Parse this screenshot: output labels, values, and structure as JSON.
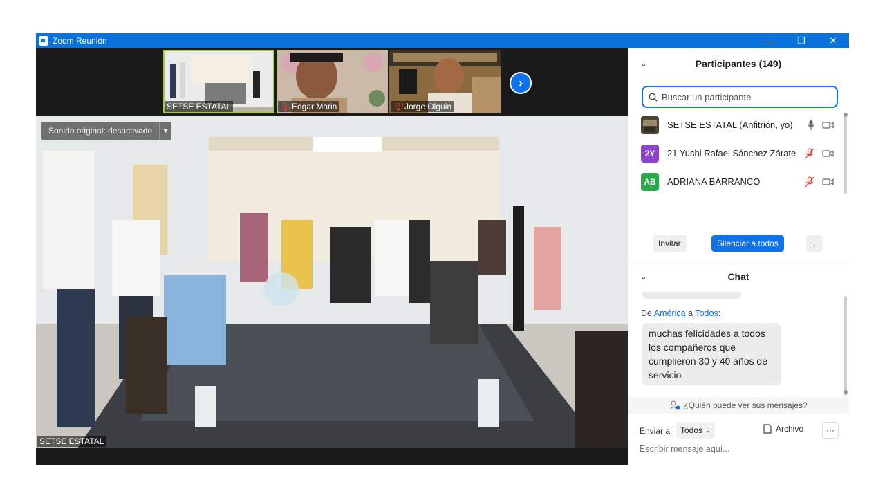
{
  "window": {
    "title": "Zoom Reunión",
    "controls": {
      "minimize": "—",
      "restore": "❐",
      "close": "✕"
    }
  },
  "thumbnails": [
    {
      "name": "SETSE ESTATAL",
      "muted": false,
      "active": true
    },
    {
      "name": "Edgar Marin",
      "muted": true,
      "active": false
    },
    {
      "name": "Jorge Olguin",
      "muted": true,
      "active": false
    }
  ],
  "next_icon": "chevron-right-icon",
  "main_video": {
    "audio_pill": "Sonido original: desactivado",
    "speaker_name": "SETSE ESTATAL"
  },
  "participants": {
    "title": "Participantes (149)",
    "search_placeholder": "Buscar un participante",
    "list": [
      {
        "initials": "",
        "name": "SETSE ESTATAL (Anfitrión, yo)",
        "avatar_color": "#6b5a3e",
        "mic": "on",
        "video": "off"
      },
      {
        "initials": "2Y",
        "name": "21 Yushi Rafael Sánchez Zárate",
        "avatar_color": "#8e44c7",
        "mic": "muted",
        "video": "off"
      },
      {
        "initials": "AB",
        "name": "ADRIANA BARRANCO",
        "avatar_color": "#2aa84a",
        "mic": "muted",
        "video": "off"
      }
    ],
    "invite_label": "Invitar",
    "mute_all_label": "Silenciar a todos",
    "more_label": "..."
  },
  "chat": {
    "title": "Chat",
    "message": {
      "prefix": "De",
      "from": "América",
      "connector": "a",
      "to": "Todos",
      "suffix": ":",
      "text": "muchas felicidades a todos los compañeros que cumplieron 30 y 40 años de servicio"
    },
    "who_can_see": "¿Quién puede ver sus mensajes?",
    "send_to_label": "Enviar a:",
    "send_to_value": "Todos",
    "file_label": "Archivo",
    "more_label": "···",
    "input_placeholder": "Escribir mensaje aquí..."
  },
  "colors": {
    "titlebar": "#0b72d9",
    "accent": "#0e72ed",
    "muted_red": "#e2463a"
  }
}
